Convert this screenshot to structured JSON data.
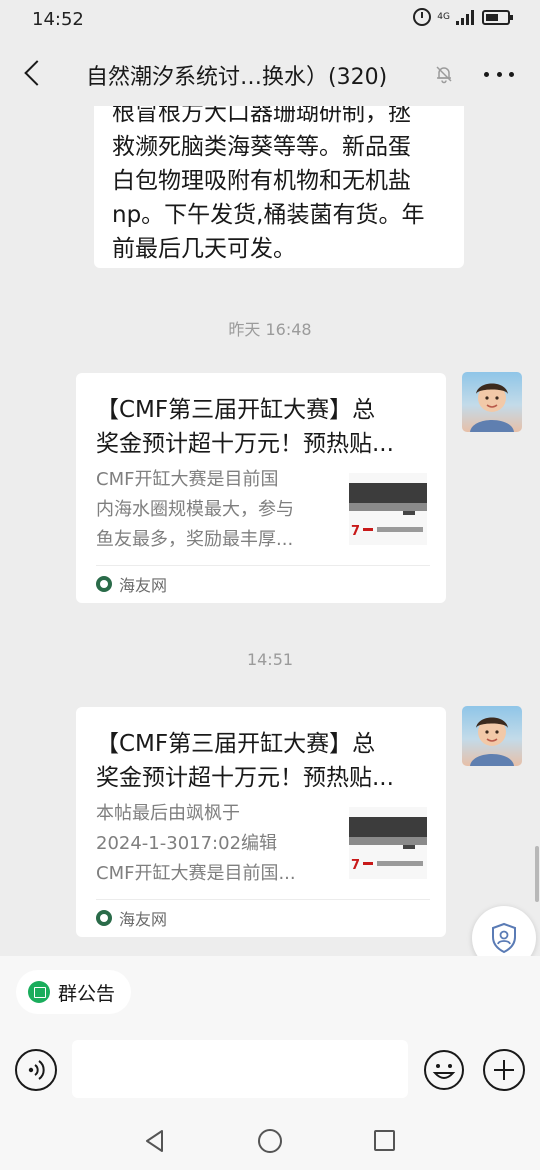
{
  "status_bar": {
    "time": "14:52",
    "network": "4G"
  },
  "header": {
    "title": "自然潮汐系统讨…换水）(320)"
  },
  "messages": {
    "text_lines": [
      "根冒根方大口器珊瑚研制，拯",
      "救濒死脑类海葵等等。新品蛋",
      "白包物理吸附有机物和无机盐",
      "np。下午发货,桶装菌有货。年",
      "前最后几天可发。"
    ],
    "time_1": "昨天 16:48",
    "card_1": {
      "title_lines": [
        "【CMF第三届开缸大赛】总",
        "奖金预计超十万元！预热贴..."
      ],
      "desc_lines": [
        "CMF开缸大赛是目前国",
        "内海水圈规模最大，参与",
        "鱼友最多，奖励最丰厚..."
      ],
      "source": "海友网"
    },
    "time_2": "14:51",
    "card_2": {
      "title_lines": [
        "【CMF第三届开缸大赛】总",
        "奖金预计超十万元！预热贴..."
      ],
      "desc_lines": [
        "本帖最后由飒枫于",
        "2024-1-3017:02编辑",
        "CMF开缸大赛是目前国..."
      ],
      "source": "海友网"
    }
  },
  "bottom": {
    "announcement": "群公告",
    "input_placeholder": ""
  }
}
